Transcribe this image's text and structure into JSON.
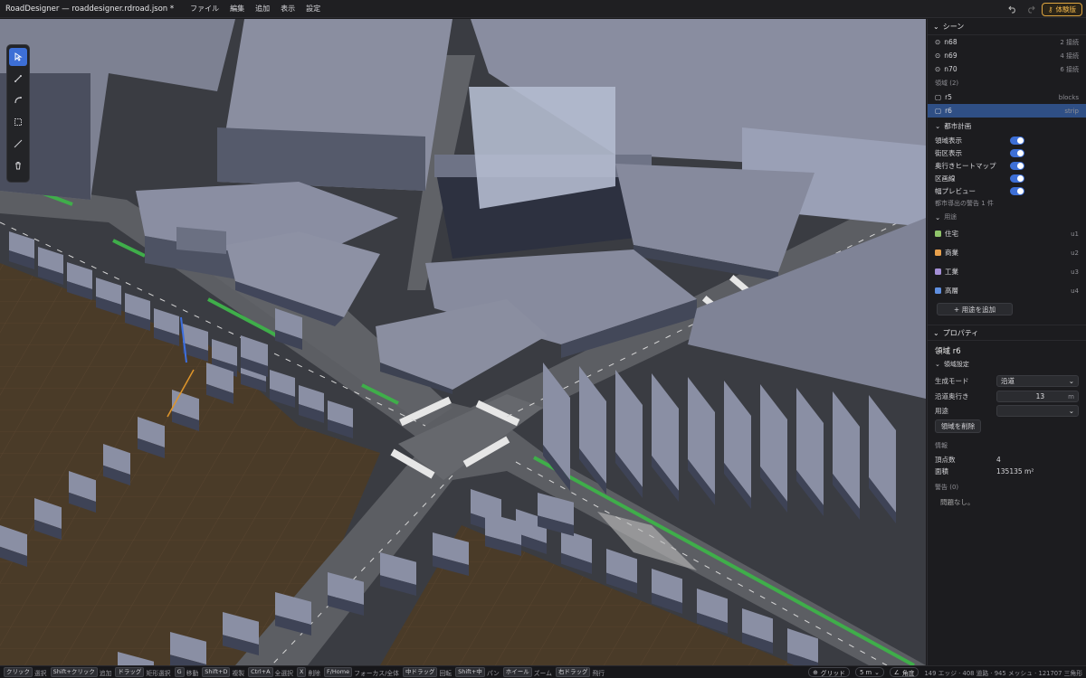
{
  "app": {
    "title": "RoadDesigner — roaddesigner.rdroad.json *"
  },
  "menu": [
    "ファイル",
    "編集",
    "追加",
    "表示",
    "設定"
  ],
  "toolbar_right": {
    "trial_label": "体験版"
  },
  "tools": [
    "select-icon",
    "line-icon",
    "curve-icon",
    "rect-select-icon",
    "measure-icon",
    "trash-icon"
  ],
  "scene": {
    "title": "シーン",
    "nodes": [
      {
        "name": "n68",
        "info": "2 接続"
      },
      {
        "name": "n69",
        "info": "4 接続"
      },
      {
        "name": "n70",
        "info": "6 接続"
      }
    ],
    "regions_header": "領域 (2)",
    "regions": [
      {
        "name": "r5",
        "info": "blocks"
      },
      {
        "name": "r6",
        "info": "strip"
      }
    ],
    "urban_title": "都市計画",
    "toggles": [
      "領域表示",
      "街区表示",
      "奥行きヒートマップ",
      "区画線",
      "幅プレビュー"
    ],
    "warning_text": "都市導出の警告 1 件",
    "uses_title": "用途",
    "uses": [
      {
        "name": "住宅",
        "code": "u1",
        "color": "#8fc46a"
      },
      {
        "name": "商業",
        "code": "u2",
        "color": "#e8a04c"
      },
      {
        "name": "工業",
        "code": "u3",
        "color": "#a48fd6"
      },
      {
        "name": "高層",
        "code": "u4",
        "color": "#5f8fe0"
      }
    ],
    "add_use_label": "+ 用途を追加"
  },
  "properties": {
    "title": "プロパティ",
    "heading": "領域 r6",
    "settings_title": "領域設定",
    "mode_label": "生成モード",
    "mode_value": "沿道",
    "depth_label": "沿道奥行き",
    "depth_value": "13",
    "depth_unit": "m",
    "use_label": "用途",
    "use_value": "",
    "delete_label": "領域を削除",
    "info_title": "情報",
    "vertex_label": "頂点数",
    "vertex_value": "4",
    "area_label": "面積",
    "area_value": "135135 m²",
    "warnings_label": "警告 (0)",
    "no_issues": "問題なし。"
  },
  "statusbar": {
    "hints": [
      {
        "key": "クリック",
        "desc": "選択"
      },
      {
        "key": "Shift+クリック",
        "desc": "追加"
      },
      {
        "key": "ドラッグ",
        "desc": "矩形選択"
      },
      {
        "key": "G",
        "desc": "移動"
      },
      {
        "key": "Shift+D",
        "desc": "複製"
      },
      {
        "key": "Ctrl+A",
        "desc": "全選択"
      },
      {
        "key": "X",
        "desc": "削除"
      },
      {
        "key": "F/Home",
        "desc": "フォーカス/全体"
      },
      {
        "key": "中ドラッグ",
        "desc": "回転"
      },
      {
        "key": "Shift+中",
        "desc": "パン"
      },
      {
        "key": "ホイール",
        "desc": "ズーム"
      },
      {
        "key": "右ドラッグ",
        "desc": "飛行"
      }
    ],
    "grid_label": "グリッド",
    "grid_size": "5 m",
    "angle_label": "角度",
    "stats": "149 エッジ · 408 道路 · 945 メッシュ · 121707 三角形"
  }
}
